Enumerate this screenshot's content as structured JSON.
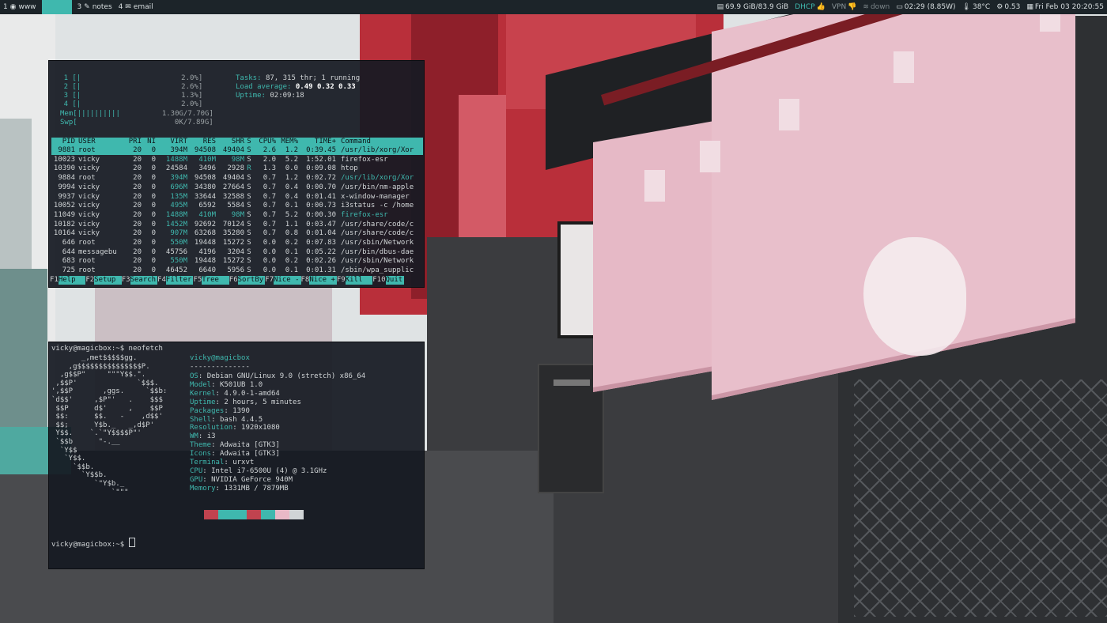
{
  "topbar": {
    "workspaces": [
      {
        "num": "1",
        "label": "www",
        "icon": "browser-icon",
        "active": false
      },
      {
        "num": "",
        "label": "",
        "icon": "",
        "active": true
      },
      {
        "num": "3",
        "label": "notes",
        "icon": "edit-icon",
        "active": false
      },
      {
        "num": "4",
        "label": "email",
        "icon": "mail-icon",
        "active": false
      }
    ],
    "status": {
      "disk": "69.9 GiB/83.9 GiB",
      "dhcp": "DHCP",
      "vpn": "VPN",
      "wifi": "down",
      "battery": "02:29 (8.85W)",
      "temperature": "38°C",
      "load": "0.53",
      "datetime": "Fri Feb 03  20:20:55"
    },
    "colors": {
      "bar_bg": "#1c2429",
      "accent": "#3fb8ae"
    }
  },
  "htop": {
    "cpus": [
      {
        "num": "1",
        "bar": "[|",
        "pct": "2.0%]"
      },
      {
        "num": "2",
        "bar": "[|",
        "pct": "2.6%]"
      },
      {
        "num": "3",
        "bar": "[|",
        "pct": "1.3%]"
      },
      {
        "num": "4",
        "bar": "[|",
        "pct": "2.0%]"
      }
    ],
    "mem": {
      "label": "Mem",
      "bar": "[||||||||||",
      "value": "1.30G/7.70G]"
    },
    "swp": {
      "label": "Swp",
      "bar": "[",
      "value": "0K/7.89G]"
    },
    "tasks_label": "Tasks: ",
    "tasks_value": "87, 315 thr; 1 running",
    "load_label": "Load average: ",
    "load_value": "0.49 0.32 0.33",
    "uptime_label": "Uptime: ",
    "uptime_value": "02:09:18",
    "columns": [
      "PID",
      "USER",
      "PRI",
      "NI",
      "VIRT",
      "RES",
      "SHR",
      "S",
      "CPU%",
      "MEM%",
      "TIME+",
      "Command"
    ],
    "processes": [
      {
        "pid": "9881",
        "user": "root",
        "pri": "20",
        "ni": "0",
        "virt": "394M",
        "res": "94508",
        "shr": "49404",
        "s": "S",
        "cpu": "2.6",
        "mem": "1.2",
        "time": "0:39.45",
        "cmd": "/usr/lib/xorg/Xor",
        "selected": true,
        "thread": false
      },
      {
        "pid": "10023",
        "user": "vicky",
        "pri": "20",
        "ni": "0",
        "virt": "1488M",
        "res": "410M",
        "shr": "98M",
        "s": "S",
        "cpu": "2.0",
        "mem": "5.2",
        "time": "1:52.01",
        "cmd": "firefox-esr",
        "selected": false,
        "thread": false
      },
      {
        "pid": "10390",
        "user": "vicky",
        "pri": "20",
        "ni": "0",
        "virt": "24584",
        "res": "3496",
        "shr": "2928",
        "s": "R",
        "cpu": "1.3",
        "mem": "0.0",
        "time": "0:09.08",
        "cmd": "htop",
        "selected": false,
        "thread": false
      },
      {
        "pid": "9884",
        "user": "root",
        "pri": "20",
        "ni": "0",
        "virt": "394M",
        "res": "94508",
        "shr": "49404",
        "s": "S",
        "cpu": "0.7",
        "mem": "1.2",
        "time": "0:02.72",
        "cmd": "/usr/lib/xorg/Xor",
        "selected": false,
        "thread": true
      },
      {
        "pid": "9994",
        "user": "vicky",
        "pri": "20",
        "ni": "0",
        "virt": "696M",
        "res": "34380",
        "shr": "27664",
        "s": "S",
        "cpu": "0.7",
        "mem": "0.4",
        "time": "0:00.70",
        "cmd": "/usr/bin/nm-apple",
        "selected": false,
        "thread": false
      },
      {
        "pid": "9937",
        "user": "vicky",
        "pri": "20",
        "ni": "0",
        "virt": "135M",
        "res": "33644",
        "shr": "32588",
        "s": "S",
        "cpu": "0.7",
        "mem": "0.4",
        "time": "0:01.41",
        "cmd": "x-window-manager",
        "selected": false,
        "thread": false
      },
      {
        "pid": "10052",
        "user": "vicky",
        "pri": "20",
        "ni": "0",
        "virt": "495M",
        "res": "6592",
        "shr": "5584",
        "s": "S",
        "cpu": "0.7",
        "mem": "0.1",
        "time": "0:00.73",
        "cmd": "i3status -c /home",
        "selected": false,
        "thread": false
      },
      {
        "pid": "11049",
        "user": "vicky",
        "pri": "20",
        "ni": "0",
        "virt": "1488M",
        "res": "410M",
        "shr": "98M",
        "s": "S",
        "cpu": "0.7",
        "mem": "5.2",
        "time": "0:00.30",
        "cmd": "firefox-esr",
        "selected": false,
        "thread": true
      },
      {
        "pid": "10182",
        "user": "vicky",
        "pri": "20",
        "ni": "0",
        "virt": "1452M",
        "res": "92692",
        "shr": "70124",
        "s": "S",
        "cpu": "0.7",
        "mem": "1.1",
        "time": "0:03.47",
        "cmd": "/usr/share/code/c",
        "selected": false,
        "thread": false
      },
      {
        "pid": "10164",
        "user": "vicky",
        "pri": "20",
        "ni": "0",
        "virt": "907M",
        "res": "63268",
        "shr": "35280",
        "s": "S",
        "cpu": "0.7",
        "mem": "0.8",
        "time": "0:01.04",
        "cmd": "/usr/share/code/c",
        "selected": false,
        "thread": false
      },
      {
        "pid": "646",
        "user": "root",
        "pri": "20",
        "ni": "0",
        "virt": "550M",
        "res": "19448",
        "shr": "15272",
        "s": "S",
        "cpu": "0.0",
        "mem": "0.2",
        "time": "0:07.83",
        "cmd": "/usr/sbin/Network",
        "selected": false,
        "thread": false
      },
      {
        "pid": "644",
        "user": "messagebu",
        "pri": "20",
        "ni": "0",
        "virt": "45756",
        "res": "4196",
        "shr": "3204",
        "s": "S",
        "cpu": "0.0",
        "mem": "0.1",
        "time": "0:05.22",
        "cmd": "/usr/bin/dbus-dae",
        "selected": false,
        "thread": false
      },
      {
        "pid": "683",
        "user": "root",
        "pri": "20",
        "ni": "0",
        "virt": "550M",
        "res": "19448",
        "shr": "15272",
        "s": "S",
        "cpu": "0.0",
        "mem": "0.2",
        "time": "0:02.26",
        "cmd": "/usr/sbin/Network",
        "selected": false,
        "thread": false
      },
      {
        "pid": "725",
        "user": "root",
        "pri": "20",
        "ni": "0",
        "virt": "46452",
        "res": "6640",
        "shr": "5956",
        "s": "S",
        "cpu": "0.0",
        "mem": "0.1",
        "time": "0:01.31",
        "cmd": "/sbin/wpa_supplic",
        "selected": false,
        "thread": false
      }
    ],
    "fkeys": [
      {
        "key": "F1",
        "label": "Help  "
      },
      {
        "key": "F2",
        "label": "Setup "
      },
      {
        "key": "F3",
        "label": "Search"
      },
      {
        "key": "F4",
        "label": "Filter"
      },
      {
        "key": "F5",
        "label": "Tree  "
      },
      {
        "key": "F6",
        "label": "SortBy"
      },
      {
        "key": "F7",
        "label": "Nice -"
      },
      {
        "key": "F8",
        "label": "Nice +"
      },
      {
        "key": "F9",
        "label": "Kill  "
      },
      {
        "key": "F10",
        "label": "Quit"
      }
    ]
  },
  "neofetch": {
    "prompt": "vicky@magicbox:~$ ",
    "command": "neofetch",
    "ascii": "       _,met$$$$$gg.\n    ,g$$$$$$$$$$$$$$$P.\n  ,g$$P\"     \"\"\"Y$$.\".\n ,$$P'              `$$$.\n',$$P       ,ggs.     `$$b:\n`d$$'     ,$P\"'   .    $$$\n $$P      d$'     ,    $$P\n $$:      $$.   -    ,d$$'\n $$;      Y$b._   _,d$P'\n Y$$.    `.`\"Y$$$$P\"'\n `$$b      \"-.__\n  `Y$$\n   `Y$$.\n     `$$b.\n       `Y$$b.\n          `\"Y$b._\n              `\"\"\"",
    "user_host": "vicky@magicbox",
    "separator": "--------------",
    "info": [
      {
        "key": "OS",
        "value": "Debian GNU/Linux 9.0 (stretch) x86_64"
      },
      {
        "key": "Model",
        "value": "K501UB 1.0"
      },
      {
        "key": "Kernel",
        "value": "4.9.0-1-amd64"
      },
      {
        "key": "Uptime",
        "value": "2 hours, 5 minutes"
      },
      {
        "key": "Packages",
        "value": "1390"
      },
      {
        "key": "Shell",
        "value": "bash 4.4.5"
      },
      {
        "key": "Resolution",
        "value": "1920x1080"
      },
      {
        "key": "WM",
        "value": "i3"
      },
      {
        "key": "Theme",
        "value": "Adwaita [GTK3]"
      },
      {
        "key": "Icons",
        "value": "Adwaita [GTK3]"
      },
      {
        "key": "Terminal",
        "value": "urxvt"
      },
      {
        "key": "CPU",
        "value": "Intel i7-6500U (4) @ 3.1GHz"
      },
      {
        "key": "GPU",
        "value": "NVIDIA GeForce 940M"
      },
      {
        "key": "Memory",
        "value": "1331MB / 7879MB"
      }
    ],
    "swatch_colors": [
      "#c1434f",
      "#3fb8ae",
      "#3fb8ae",
      "#c1434f",
      "#3fb8ae",
      "#e9b9c7",
      "#d0d4d6"
    ],
    "final_prompt": "vicky@magicbox:~$ "
  }
}
